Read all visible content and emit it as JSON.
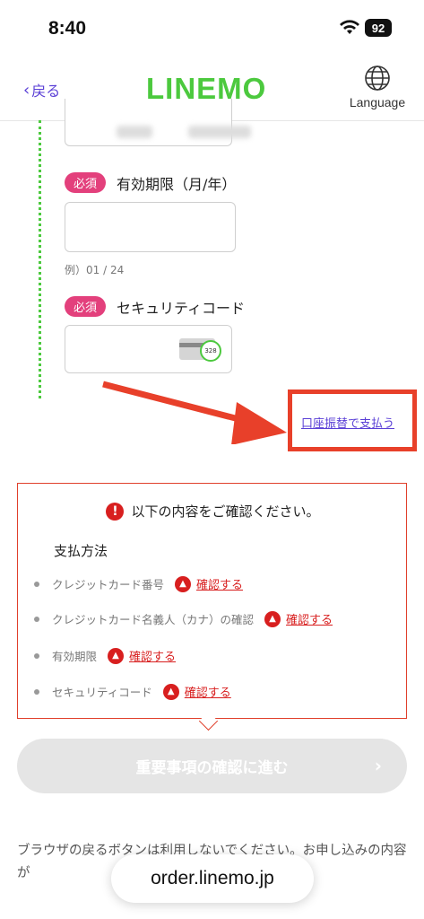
{
  "status_bar": {
    "time": "8:40",
    "battery": "92"
  },
  "header": {
    "back_label": "戻る",
    "logo": "LINEMO",
    "language_label": "Language"
  },
  "form": {
    "required_badge": "必須",
    "expiry_label": "有効期限（月/年）",
    "expiry_value": "",
    "expiry_example": "例）01 / 24",
    "security_label": "セキュリティコード",
    "security_value": "",
    "security_card_hint": "328"
  },
  "account_transfer_link": "口座振替で支払う",
  "error_panel": {
    "title": "以下の内容をご確認ください。",
    "section_title": "支払方法",
    "confirm_label": "確認する",
    "items": [
      {
        "label": "クレジットカード番号"
      },
      {
        "label": "クレジットカード名義人（カナ）の確認"
      },
      {
        "label": "有効期限"
      },
      {
        "label": "セキュリティコード"
      }
    ]
  },
  "next_button": {
    "label": "重要事項の確認に進む"
  },
  "note_text": "ブラウザの戻るボタンは利用しないでください。お申し込みの内容が",
  "url_bar": {
    "domain": "order.linemo.jp"
  },
  "colors": {
    "brand_green": "#4cc93e",
    "error_red": "#d81f1f",
    "link_purple": "#5a3fd6",
    "annotation_red": "#e8402a"
  }
}
